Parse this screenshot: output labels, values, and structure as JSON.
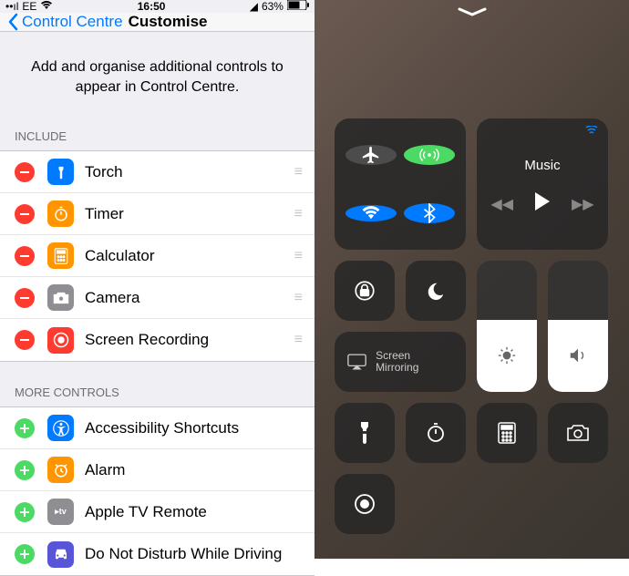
{
  "status": {
    "carrier": "EE",
    "time": "16:50",
    "battery": "63%"
  },
  "nav": {
    "back": "Control Centre",
    "title": "Customise"
  },
  "description": "Add and organise additional controls to appear in Control Centre.",
  "sections": {
    "include": "INCLUDE",
    "more": "MORE CONTROLS"
  },
  "include": [
    {
      "label": "Torch",
      "icon": "torch",
      "color": "blue"
    },
    {
      "label": "Timer",
      "icon": "timer",
      "color": "orange"
    },
    {
      "label": "Calculator",
      "icon": "calculator",
      "color": "orange"
    },
    {
      "label": "Camera",
      "icon": "camera",
      "color": "gray"
    },
    {
      "label": "Screen Recording",
      "icon": "record",
      "color": "red"
    }
  ],
  "more": [
    {
      "label": "Accessibility Shortcuts",
      "icon": "accessibility",
      "color": "blue"
    },
    {
      "label": "Alarm",
      "icon": "alarm",
      "color": "orange"
    },
    {
      "label": "Apple TV Remote",
      "icon": "appletv",
      "color": "gray"
    },
    {
      "label": "Do Not Disturb While Driving",
      "icon": "dnd-driving",
      "color": "purple"
    }
  ],
  "cc": {
    "music": "Music",
    "screen_mirroring": "Screen Mirroring"
  }
}
